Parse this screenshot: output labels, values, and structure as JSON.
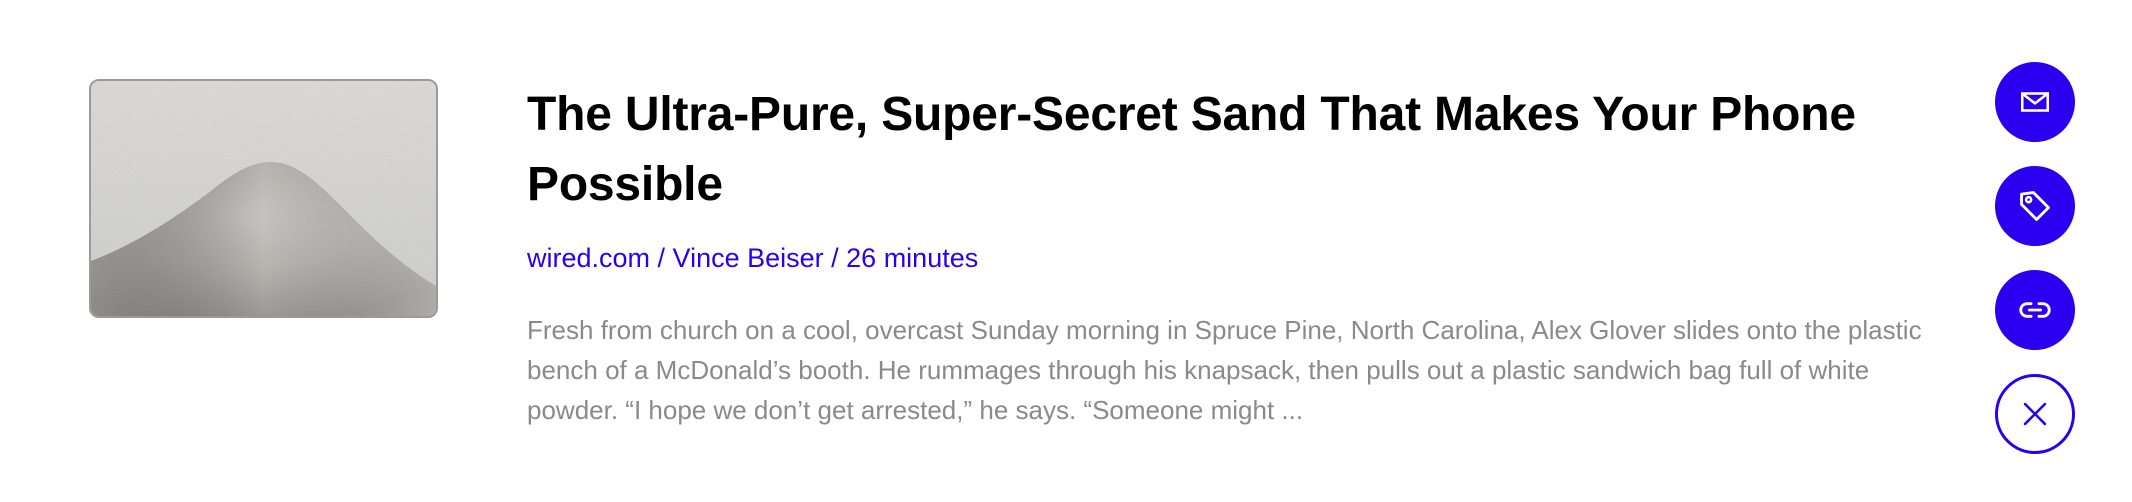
{
  "article": {
    "title": "The Ultra-Pure, Super-Secret Sand That Makes Your Phone Possible",
    "source": "wired.com",
    "author": "Vince Beiser",
    "read_time": "26 minutes",
    "separator": " / ",
    "excerpt": "Fresh from church on a cool, overcast Sunday morning in Spruce Pine, North Carolina, Alex Glover slides onto the plastic bench of a McDonald’s booth. He rummages through his knapsack, then pulls out a plastic sandwich bag full of white powder. “I hope we don’t get arrested,” he says. “Someone might ..."
  },
  "actions": [
    {
      "icon": "mail-icon",
      "style": "filled"
    },
    {
      "icon": "tag-icon",
      "style": "filled"
    },
    {
      "icon": "link-icon",
      "style": "filled"
    },
    {
      "icon": "close-icon",
      "style": "outline"
    }
  ],
  "colors": {
    "accent": "#2b00f0",
    "title": "#000000",
    "excerpt": "#8a8a8a",
    "thumb_border": "#9a9a9a"
  }
}
